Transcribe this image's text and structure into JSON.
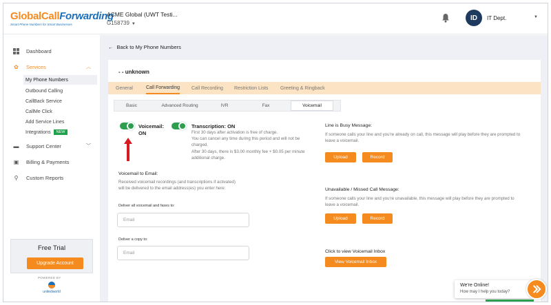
{
  "brand": {
    "logo_part1": "Global",
    "logo_part2": "Call",
    "logo_part3": "Forwarding",
    "tagline": "Smart Phone Numbers for Smart Businesses",
    "accent_color": "#f58a1f",
    "blue_color": "#1d6fb8"
  },
  "header": {
    "account_name": "ACME Global (UWT Testi...",
    "account_number": "G158739",
    "avatar_initials": "ID",
    "user_name": "IT Dept."
  },
  "sidebar": {
    "items": [
      {
        "label": "Dashboard",
        "icon": "dashboard-icon"
      },
      {
        "label": "Services",
        "icon": "gear-icon"
      },
      {
        "label": "Support Center",
        "icon": "support-icon"
      },
      {
        "label": "Billing & Payments",
        "icon": "billing-icon"
      },
      {
        "label": "Custom Reports",
        "icon": "search-icon"
      }
    ],
    "sub_items": [
      {
        "label": "My Phone Numbers"
      },
      {
        "label": "Outbound Calling"
      },
      {
        "label": "CallBack Service"
      },
      {
        "label": "CallMe Click"
      },
      {
        "label": "Add Service Lines"
      },
      {
        "label": "Integrations"
      }
    ],
    "new_badge": "NEW",
    "trial_title": "Free Trial",
    "upgrade_label": "Upgrade Account",
    "powered_by": "POWERED BY",
    "powered_logo": "unitedworld"
  },
  "main": {
    "back_label": "Back to My Phone Numbers",
    "title": "- - unknown",
    "tabs": [
      {
        "label": "General"
      },
      {
        "label": "Call Forwarding"
      },
      {
        "label": "Call Recording"
      },
      {
        "label": "Restriction Lists"
      },
      {
        "label": "Greeting & Ringback"
      }
    ],
    "subtabs": [
      {
        "label": "Basic"
      },
      {
        "label": "Advanced Routing"
      },
      {
        "label": "IVR"
      },
      {
        "label": "Fax"
      },
      {
        "label": "Voicemail"
      }
    ],
    "voicemail_label": "Voicemail:",
    "voicemail_state": "ON",
    "transcription_label": "Transcription: ON",
    "transcription_lines": [
      "First 30 days after activation is free of charge.",
      "You can cancel any time during this period and will not be",
      "charged.",
      "After 30 days, there is $3.00 monthly fee + $0.05 per minute",
      "additional charge."
    ],
    "vm_email_title": "Voicemail to Email:",
    "vm_email_desc1": "Received voicemail recordings (and transcriptions if activated)",
    "vm_email_desc2": "will be delivered to the email address(es) you enter here:",
    "deliver_all_label": "Deliver all voicemail and faxes to:",
    "email_placeholder": "Email",
    "deliver_copy_label": "Deliver a copy to:",
    "busy_title": "Line is Busy Message:",
    "busy_desc1": "If someone calls your line and you're already on call, this message will play before they are prompted to",
    "busy_desc2": "leave a voicemail.",
    "upload_label": "Upload",
    "record_label": "Record",
    "unavail_title": "Unavailable / Missed Call Message:",
    "unavail_desc1": "If someone calls your line and you're unavailable, this message will play before they are prompted to",
    "unavail_desc2": "leave a voicemail.",
    "inbox_title": "Click to view Voicemail Inbox",
    "inbox_button": "View Voicemail Inbox"
  },
  "chat": {
    "title": "We're Online!",
    "subtitle": "How may I help you today?"
  }
}
